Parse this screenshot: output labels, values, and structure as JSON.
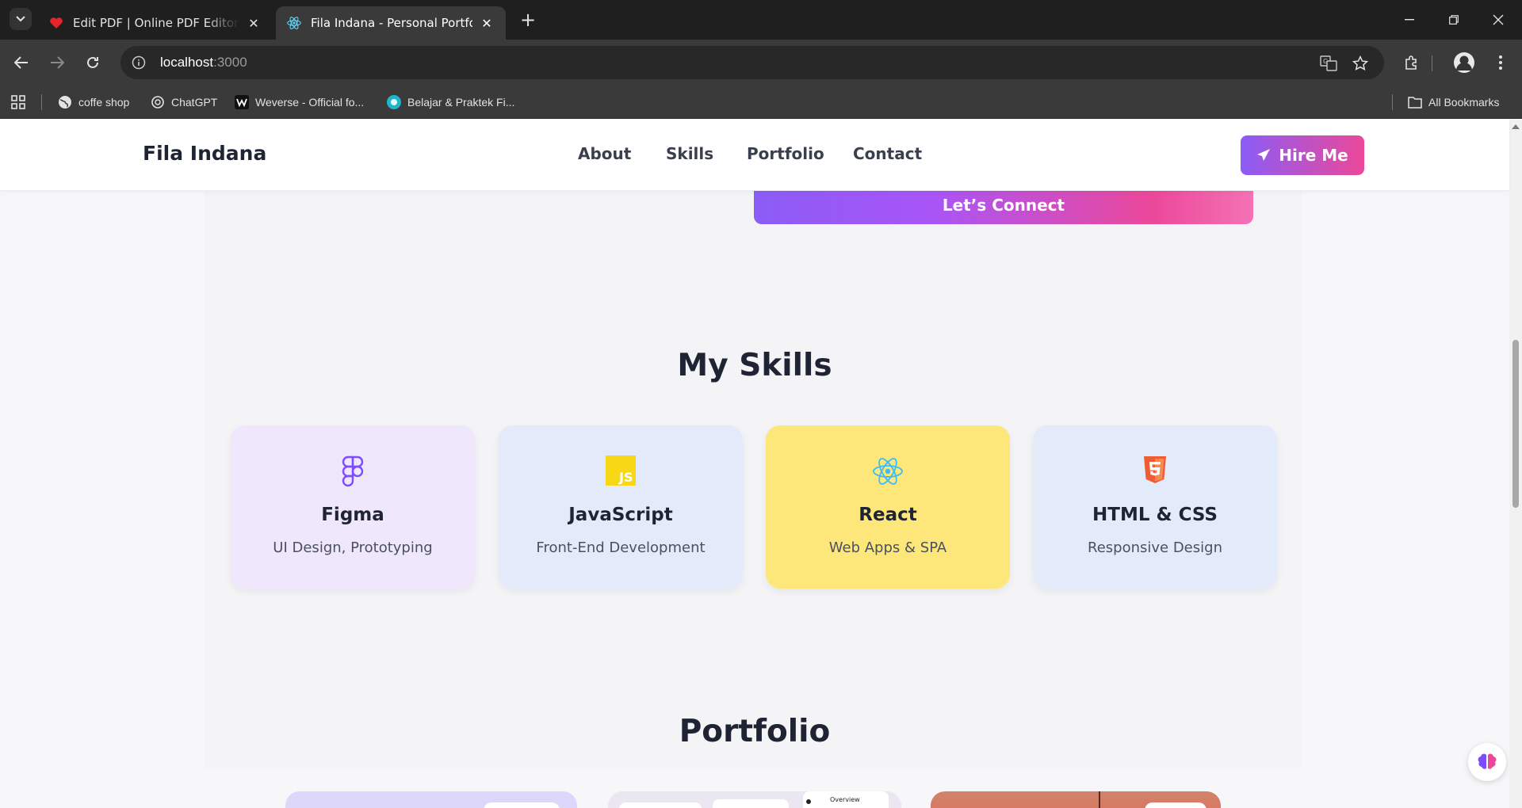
{
  "browser": {
    "tabs": [
      {
        "title": "Edit PDF | Online PDF Editor and",
        "favicon": "heart-pdf-icon",
        "active": false
      },
      {
        "title": "Fila Indana - Personal Portfolio",
        "favicon": "react-icon",
        "active": true
      }
    ],
    "url_host": "localhost",
    "url_port": ":3000",
    "bookmarks": [
      {
        "label": "coffe shop",
        "icon": "globe-icon"
      },
      {
        "label": "ChatGPT",
        "icon": "chatgpt-icon"
      },
      {
        "label": "Weverse - Official fo...",
        "icon": "weverse-icon"
      },
      {
        "label": "Belajar & Praktek Fi...",
        "icon": "circle-logo-icon"
      }
    ],
    "all_bookmarks": "All Bookmarks"
  },
  "site": {
    "brand": "Fila Indana",
    "nav": [
      "About",
      "Skills",
      "Portfolio",
      "Contact"
    ],
    "hire_label": "Hire Me",
    "connect_label": "Let’s Connect",
    "accent_start": "#8b5cf6",
    "accent_end": "#ec4899"
  },
  "skills": {
    "title": "My Skills",
    "items": [
      {
        "name": "Figma",
        "desc": "UI Design, Prototyping",
        "icon": "figma-icon",
        "bg": "#efe7fb"
      },
      {
        "name": "JavaScript",
        "desc": "Front-End Development",
        "icon": "javascript-icon",
        "bg": "#e3ebfb"
      },
      {
        "name": "React",
        "desc": "Web Apps & SPA",
        "icon": "react-icon",
        "bg": "#fde77a"
      },
      {
        "name": "HTML & CSS",
        "desc": "Responsive Design",
        "icon": "html5-icon",
        "bg": "#e3ebfb"
      }
    ]
  },
  "portfolio": {
    "title": "Portfolio",
    "overview_label": "Overview"
  }
}
